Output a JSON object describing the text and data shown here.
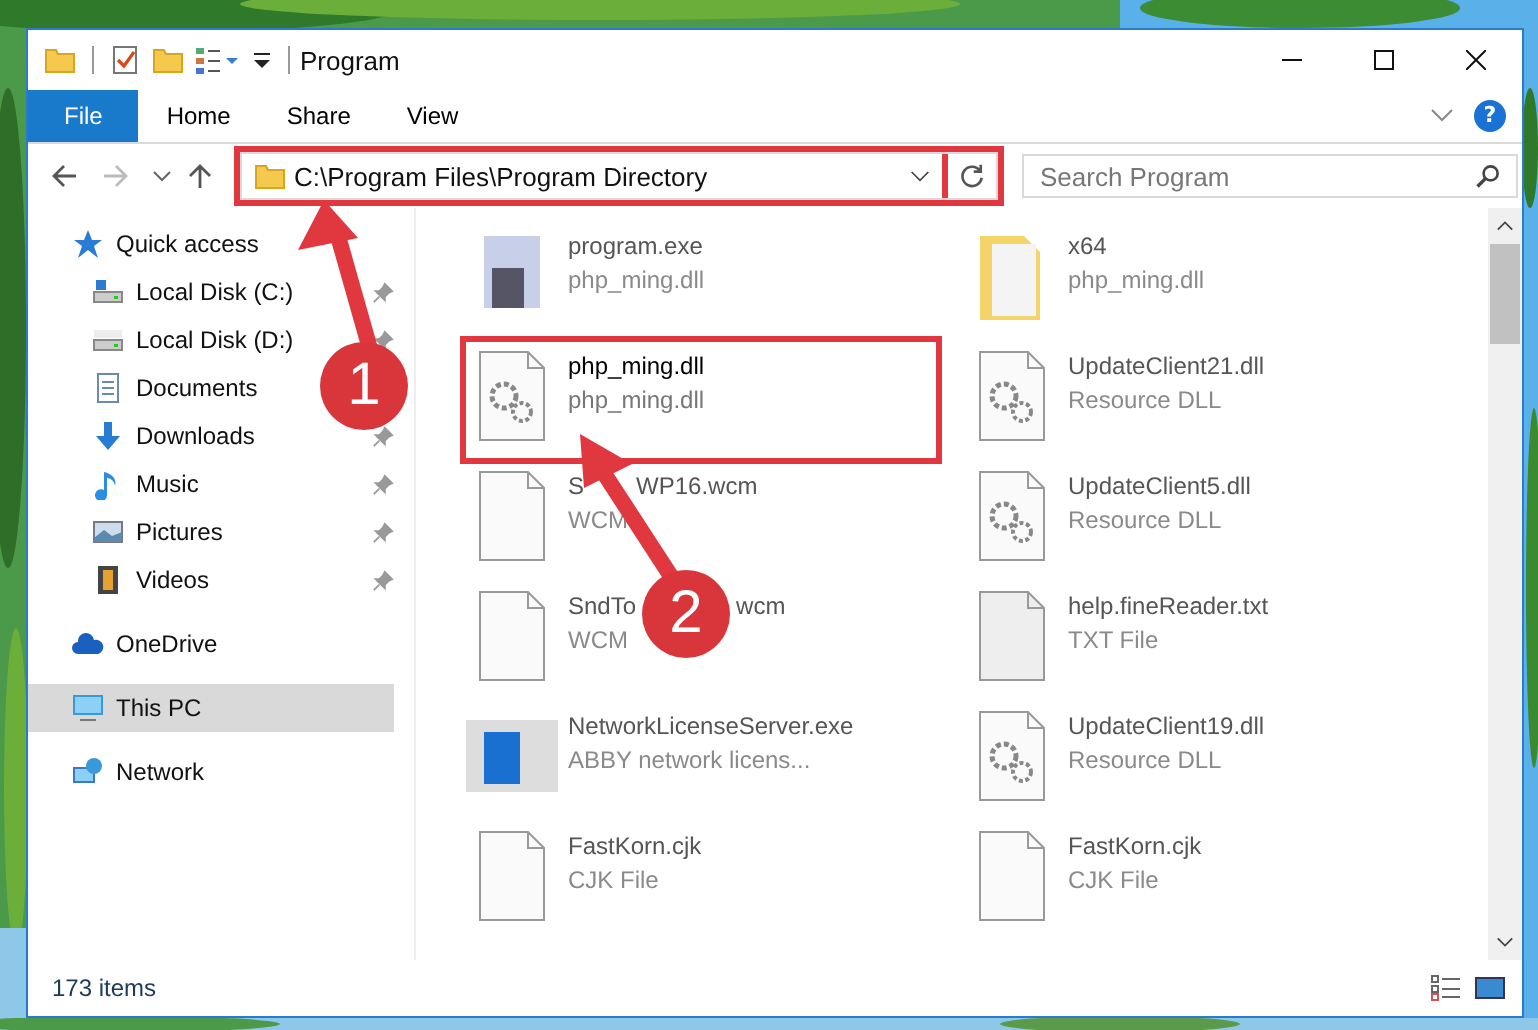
{
  "window": {
    "title": "Program"
  },
  "ribbon_tabs": [
    {
      "label": "File",
      "kind": "file"
    },
    {
      "label": "Home",
      "kind": "tab"
    },
    {
      "label": "Share",
      "kind": "tab"
    },
    {
      "label": "View",
      "kind": "tab"
    }
  ],
  "help_button": "?",
  "address": {
    "path": "C:\\Program Files\\Program Directory",
    "highlighted": true
  },
  "search": {
    "placeholder": "Search Program"
  },
  "sidebar": {
    "items": [
      {
        "label": "Quick access",
        "selected": false,
        "children": [
          {
            "label": "Local Disk (C:)",
            "pinned": true,
            "selected": false
          },
          {
            "label": "Local Disk (D:)",
            "pinned": true,
            "selected": false
          },
          {
            "label": "Documents",
            "selected": false
          },
          {
            "label": "Downloads",
            "pinned": true,
            "selected": false
          },
          {
            "label": "Music",
            "pinned": true,
            "selected": false
          },
          {
            "label": "Pictures",
            "pinned": true,
            "selected": false
          },
          {
            "label": "Videos",
            "pinned": true,
            "selected": false
          }
        ]
      },
      {
        "label": "OneDrive",
        "selected": false
      },
      {
        "label": "This PC",
        "selected": true
      },
      {
        "label": "Network",
        "selected": false
      }
    ]
  },
  "files": [
    {
      "name": [
        "program.exe"
      ],
      "type": [
        "php_ming.dll"
      ],
      "kind": "exe",
      "blurred": true
    },
    {
      "name": [
        "x64"
      ],
      "type": [
        "php_ming.dll"
      ],
      "kind": "folder",
      "blurred": true
    },
    {
      "name": [
        "php_ming.dll"
      ],
      "type": [
        "php_ming.dll"
      ],
      "kind": "dll",
      "blurred": false,
      "highlighted": true
    },
    {
      "name": [
        "UpdateClient21.dll"
      ],
      "type": [
        "Resource DLL"
      ],
      "kind": "dll",
      "blurred": true
    },
    {
      "name": [
        "S",
        "WP16.wcm"
      ],
      "type": [
        "WCM"
      ],
      "kind": "blank",
      "blurred": true
    },
    {
      "name": [
        "UpdateClient5.dll"
      ],
      "type": [
        "Resource DLL"
      ],
      "kind": "dll",
      "blurred": true
    },
    {
      "name": [
        "SndTo",
        "wcm"
      ],
      "type": [
        "WCM"
      ],
      "kind": "blank",
      "blurred": true
    },
    {
      "name": [
        "help.fineReader.txt"
      ],
      "type": [
        "TXT File"
      ],
      "kind": "txt",
      "blurred": true
    },
    {
      "name": [
        "NetworkLicenseServer.exe"
      ],
      "type": [
        "ABBY network licens..."
      ],
      "kind": "app",
      "blurred": true
    },
    {
      "name": [
        "UpdateClient19.dll"
      ],
      "type": [
        "Resource DLL"
      ],
      "kind": "dll",
      "blurred": true
    },
    {
      "name": [
        "FastKorn.cjk"
      ],
      "type": [
        "CJK File"
      ],
      "kind": "blank",
      "blurred": true
    },
    {
      "name": [
        "FastKorn.cjk"
      ],
      "type": [
        "CJK File"
      ],
      "kind": "blank",
      "blurred": true
    }
  ],
  "status_bar": {
    "count": "173 items"
  },
  "annotations": [
    {
      "label": "1"
    },
    {
      "label": "2"
    }
  ]
}
